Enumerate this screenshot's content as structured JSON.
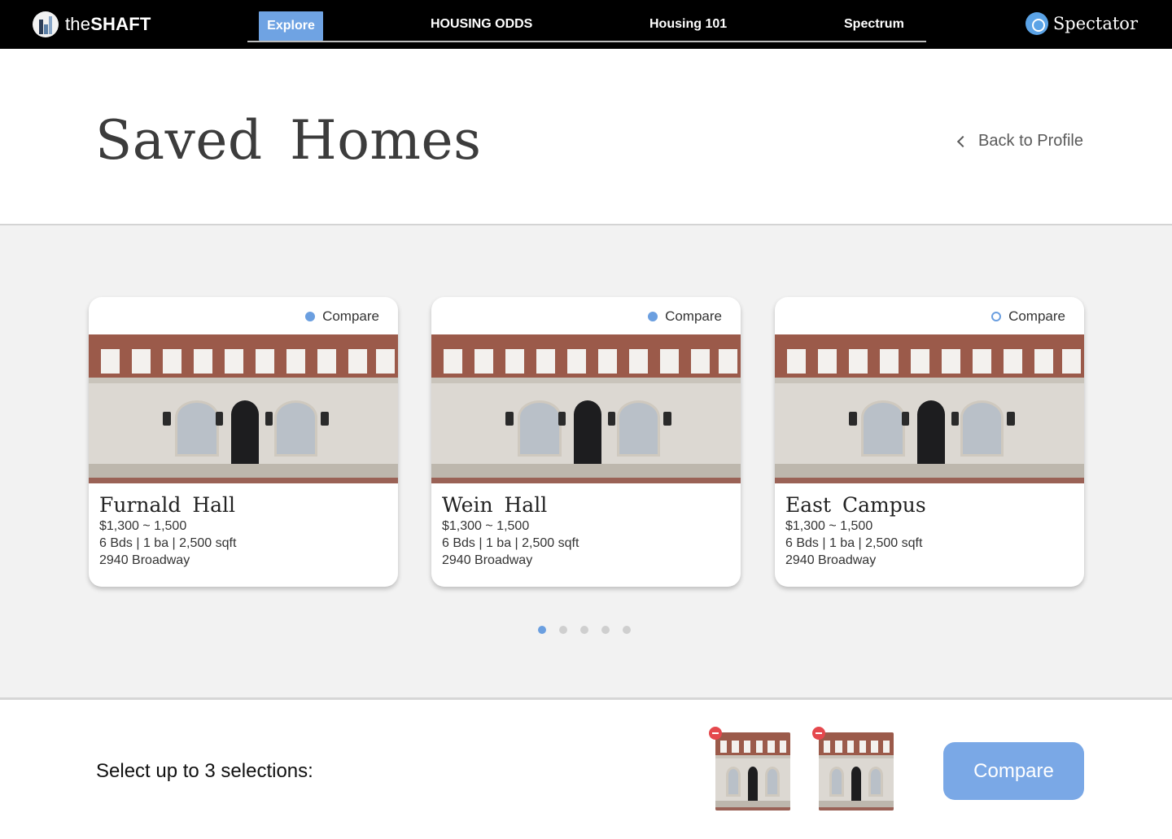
{
  "nav": {
    "brand_prefix": "the",
    "brand_bold": "SHAFT",
    "items": [
      "Explore",
      "HOUSING ODDS",
      "Housing 101",
      "Spectrum"
    ],
    "active": "Explore",
    "publisher": "Spectator"
  },
  "header": {
    "title": "Saved  Homes",
    "back_label": "Back to Profile"
  },
  "cards": [
    {
      "compare_label": "Compare",
      "compare_selected": true,
      "name": "Furnald  Hall",
      "price": "$1,300 ~ 1,500",
      "specs": "6 Bds | 1 ba | 2,500 sqft",
      "address": "2940 Broadway"
    },
    {
      "compare_label": "Compare",
      "compare_selected": true,
      "name": "Wein  Hall",
      "price": "$1,300 ~ 1,500",
      "specs": "6 Bds | 1 ba | 2,500 sqft",
      "address": "2940 Broadway"
    },
    {
      "compare_label": "Compare",
      "compare_selected": false,
      "name": "East  Campus",
      "price": "$1,300 ~ 1,500",
      "specs": "6 Bds | 1 ba | 2,500 sqft",
      "address": "2940 Broadway"
    }
  ],
  "pager": {
    "pages": 5,
    "current": 1
  },
  "bottom": {
    "select_label": "Select up to 3 selections:",
    "selected_count": 2,
    "compare_button": "Compare"
  },
  "colors": {
    "accent": "#6b9fe0",
    "nav_bg": "#000000",
    "remove": "#e5484d",
    "gallery_bg": "#f2f2f2"
  }
}
